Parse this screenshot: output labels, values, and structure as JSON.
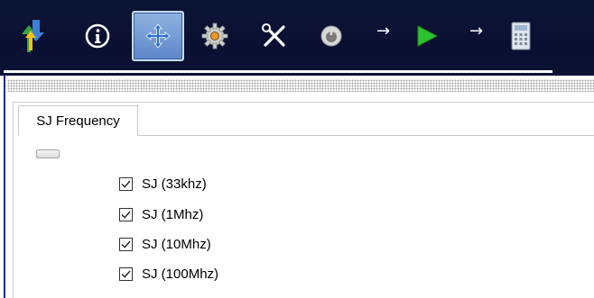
{
  "toolbar": {
    "buttons": [
      {
        "icon": "up-down-arrows-icon"
      },
      {
        "icon": "info-icon"
      },
      {
        "icon": "move-crosshair-icon",
        "active": true
      },
      {
        "icon": "gear-icon"
      },
      {
        "icon": "tools-icon"
      },
      {
        "icon": "power-icon"
      },
      {
        "icon": "play-icon"
      },
      {
        "icon": "calculator-icon"
      }
    ],
    "arrow": "→"
  },
  "tab": {
    "label": "SJ Frequency"
  },
  "checkboxes": [
    {
      "label": "SJ (33khz)",
      "checked": true
    },
    {
      "label": "SJ (1Mhz)",
      "checked": true
    },
    {
      "label": "SJ (10Mhz)",
      "checked": true
    },
    {
      "label": "SJ (100Mhz)",
      "checked": true
    }
  ],
  "colors": {
    "toolbar_bg": "#0b1234",
    "active_button": "#6f97d4",
    "play_green": "#2fc22f"
  }
}
